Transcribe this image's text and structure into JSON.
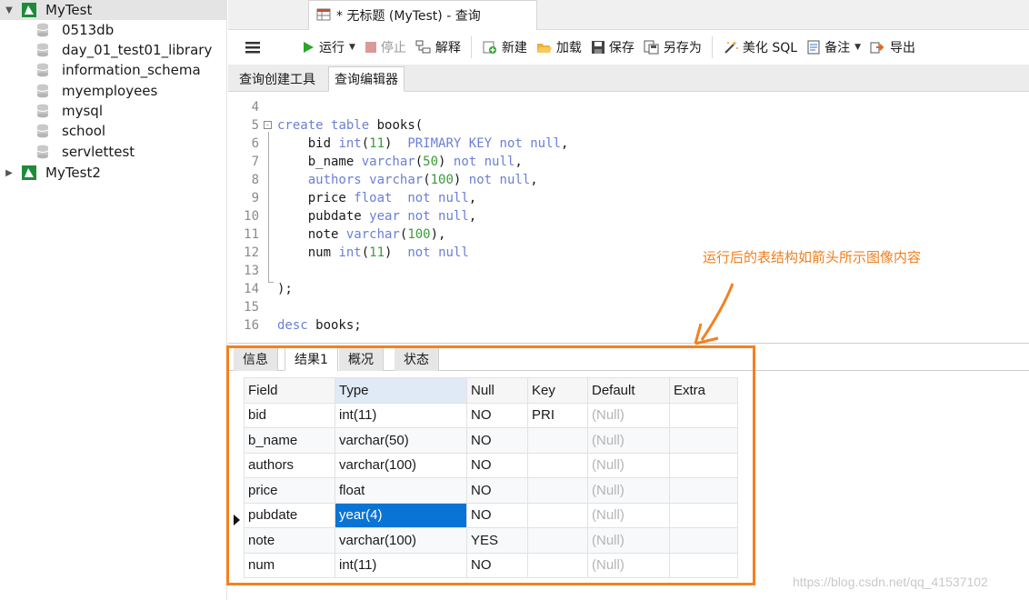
{
  "tree": {
    "connections": [
      {
        "label": "MyTest",
        "expanded": true
      },
      {
        "label": "MyTest2",
        "expanded": false
      }
    ],
    "databases": [
      "0513db",
      "day_01_test01_library",
      "information_schema",
      "myemployees",
      "mysql",
      "school",
      "servlettest"
    ]
  },
  "tab": {
    "title": "* 无标题 (MyTest) - 查询"
  },
  "toolbar": {
    "run": "运行",
    "stop": "停止",
    "explain": "解释",
    "new": "新建",
    "load": "加载",
    "save": "保存",
    "save_as": "另存为",
    "beautify": "美化 SQL",
    "note": "备注",
    "export": "导出"
  },
  "subtabs": [
    "查询创建工具",
    "查询编辑器"
  ],
  "editor": {
    "lines": [
      {
        "n": "4",
        "code": []
      },
      {
        "n": "5",
        "code": [
          [
            "kw",
            "create"
          ],
          [
            "t",
            " "
          ],
          [
            "kw",
            "table"
          ],
          [
            "t",
            " books("
          ]
        ]
      },
      {
        "n": "6",
        "code": [
          [
            "t",
            "    bid "
          ],
          [
            "kw",
            "int"
          ],
          [
            "t",
            "("
          ],
          [
            "num",
            "11"
          ],
          [
            "t",
            ")  "
          ],
          [
            "kw",
            "PRIMARY"
          ],
          [
            "t",
            " "
          ],
          [
            "kw",
            "KEY"
          ],
          [
            "t",
            " "
          ],
          [
            "kw",
            "not"
          ],
          [
            "t",
            " "
          ],
          [
            "kw",
            "null"
          ],
          [
            "t",
            ","
          ]
        ]
      },
      {
        "n": "7",
        "code": [
          [
            "t",
            "    b_name "
          ],
          [
            "kw",
            "varchar"
          ],
          [
            "t",
            "("
          ],
          [
            "num",
            "50"
          ],
          [
            "t",
            ") "
          ],
          [
            "kw",
            "not"
          ],
          [
            "t",
            " "
          ],
          [
            "kw",
            "null"
          ],
          [
            "t",
            ","
          ]
        ]
      },
      {
        "n": "8",
        "code": [
          [
            "t",
            "    "
          ],
          [
            "kw",
            "authors"
          ],
          [
            "t",
            " "
          ],
          [
            "kw",
            "varchar"
          ],
          [
            "t",
            "("
          ],
          [
            "num",
            "100"
          ],
          [
            "t",
            ") "
          ],
          [
            "kw",
            "not"
          ],
          [
            "t",
            " "
          ],
          [
            "kw",
            "null"
          ],
          [
            "t",
            ","
          ]
        ]
      },
      {
        "n": "9",
        "code": [
          [
            "t",
            "    price "
          ],
          [
            "kw",
            "float"
          ],
          [
            "t",
            "  "
          ],
          [
            "kw",
            "not"
          ],
          [
            "t",
            " "
          ],
          [
            "kw",
            "null"
          ],
          [
            "t",
            ","
          ]
        ]
      },
      {
        "n": "10",
        "code": [
          [
            "t",
            "    pubdate "
          ],
          [
            "kw",
            "year"
          ],
          [
            "t",
            " "
          ],
          [
            "kw",
            "not"
          ],
          [
            "t",
            " "
          ],
          [
            "kw",
            "null"
          ],
          [
            "t",
            ","
          ]
        ]
      },
      {
        "n": "11",
        "code": [
          [
            "t",
            "    note "
          ],
          [
            "kw",
            "varchar"
          ],
          [
            "t",
            "("
          ],
          [
            "num",
            "100"
          ],
          [
            "t",
            "),"
          ]
        ]
      },
      {
        "n": "12",
        "code": [
          [
            "t",
            "    num "
          ],
          [
            "kw",
            "int"
          ],
          [
            "t",
            "("
          ],
          [
            "num",
            "11"
          ],
          [
            "t",
            ")  "
          ],
          [
            "kw",
            "not"
          ],
          [
            "t",
            " "
          ],
          [
            "kw",
            "null"
          ]
        ]
      },
      {
        "n": "13",
        "code": []
      },
      {
        "n": "14",
        "code": [
          [
            "t",
            ");"
          ]
        ]
      },
      {
        "n": "15",
        "code": []
      },
      {
        "n": "16",
        "code": [
          [
            "kw",
            "desc"
          ],
          [
            "t",
            " books;"
          ]
        ]
      }
    ]
  },
  "annotation": "运行后的表结构如箭头所示图像内容",
  "result_tabs": [
    "信息",
    "结果1",
    "概况",
    "状态"
  ],
  "grid": {
    "columns": [
      "Field",
      "Type",
      "Null",
      "Key",
      "Default",
      "Extra"
    ],
    "rows": [
      [
        "bid",
        "int(11)",
        "NO",
        "PRI",
        "(Null)",
        ""
      ],
      [
        "b_name",
        "varchar(50)",
        "NO",
        "",
        "(Null)",
        ""
      ],
      [
        "authors",
        "varchar(100)",
        "NO",
        "",
        "(Null)",
        ""
      ],
      [
        "price",
        "float",
        "NO",
        "",
        "(Null)",
        ""
      ],
      [
        "pubdate",
        "year(4)",
        "NO",
        "",
        "(Null)",
        ""
      ],
      [
        "note",
        "varchar(100)",
        "YES",
        "",
        "(Null)",
        ""
      ],
      [
        "num",
        "int(11)",
        "NO",
        "",
        "(Null)",
        ""
      ]
    ]
  },
  "watermark": "https://blog.csdn.net/qq_41537102",
  "colors": {
    "accent": "#f5801f",
    "selection": "#0a74d6",
    "keyword": "#6b7fd4",
    "number": "#3b9b3b"
  }
}
